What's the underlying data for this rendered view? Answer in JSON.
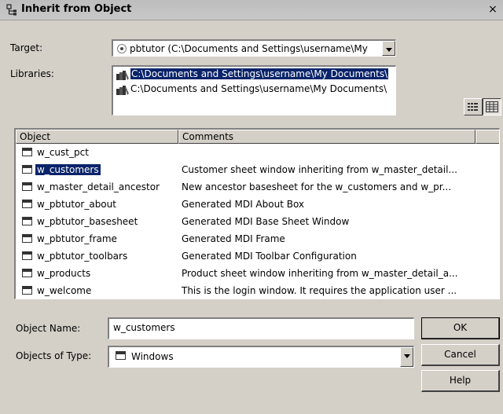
{
  "window": {
    "title": "Inherit from Object",
    "close_label": "×"
  },
  "target": {
    "label": "Target:",
    "value": "pbtutor (C:\\Documents and Settings\\username\\My"
  },
  "libraries": {
    "label": "Libraries:",
    "items": [
      {
        "path": "C:\\Documents and Settings\\username\\My Documents\\",
        "selected": true
      },
      {
        "path": "C:\\Documents and Settings\\username\\My Documents\\",
        "selected": false
      }
    ]
  },
  "view_buttons": [
    {
      "name": "list-view-icon",
      "pressed": false
    },
    {
      "name": "details-view-icon",
      "pressed": true
    }
  ],
  "object_list": {
    "columns": [
      "Object",
      "Comments"
    ],
    "rows": [
      {
        "name": "w_cust_pct",
        "comment": ""
      },
      {
        "name": "w_customers",
        "comment": "Customer sheet window inheriting from w_master_detail...",
        "selected": true
      },
      {
        "name": "w_master_detail_ancestor",
        "comment": "New ancestor basesheet for the w_customers and w_pr..."
      },
      {
        "name": "w_pbtutor_about",
        "comment": "Generated MDI About Box"
      },
      {
        "name": "w_pbtutor_basesheet",
        "comment": "Generated MDI Base Sheet Window"
      },
      {
        "name": "w_pbtutor_frame",
        "comment": "Generated MDI Frame"
      },
      {
        "name": "w_pbtutor_toolbars",
        "comment": "Generated MDI Toolbar Configuration"
      },
      {
        "name": "w_products",
        "comment": "Product sheet window inheriting from w_master_detail_a..."
      },
      {
        "name": "w_welcome",
        "comment": "This is the login window. It requires the application user ..."
      }
    ]
  },
  "object_name": {
    "label": "Object Name:",
    "value": "w_customers"
  },
  "objects_of_type": {
    "label": "Objects of Type:",
    "value": "Windows"
  },
  "buttons": {
    "ok": "OK",
    "cancel": "Cancel",
    "help": "Help"
  },
  "colors": {
    "face": "#d4d0c8",
    "selection": "#0a246a"
  }
}
